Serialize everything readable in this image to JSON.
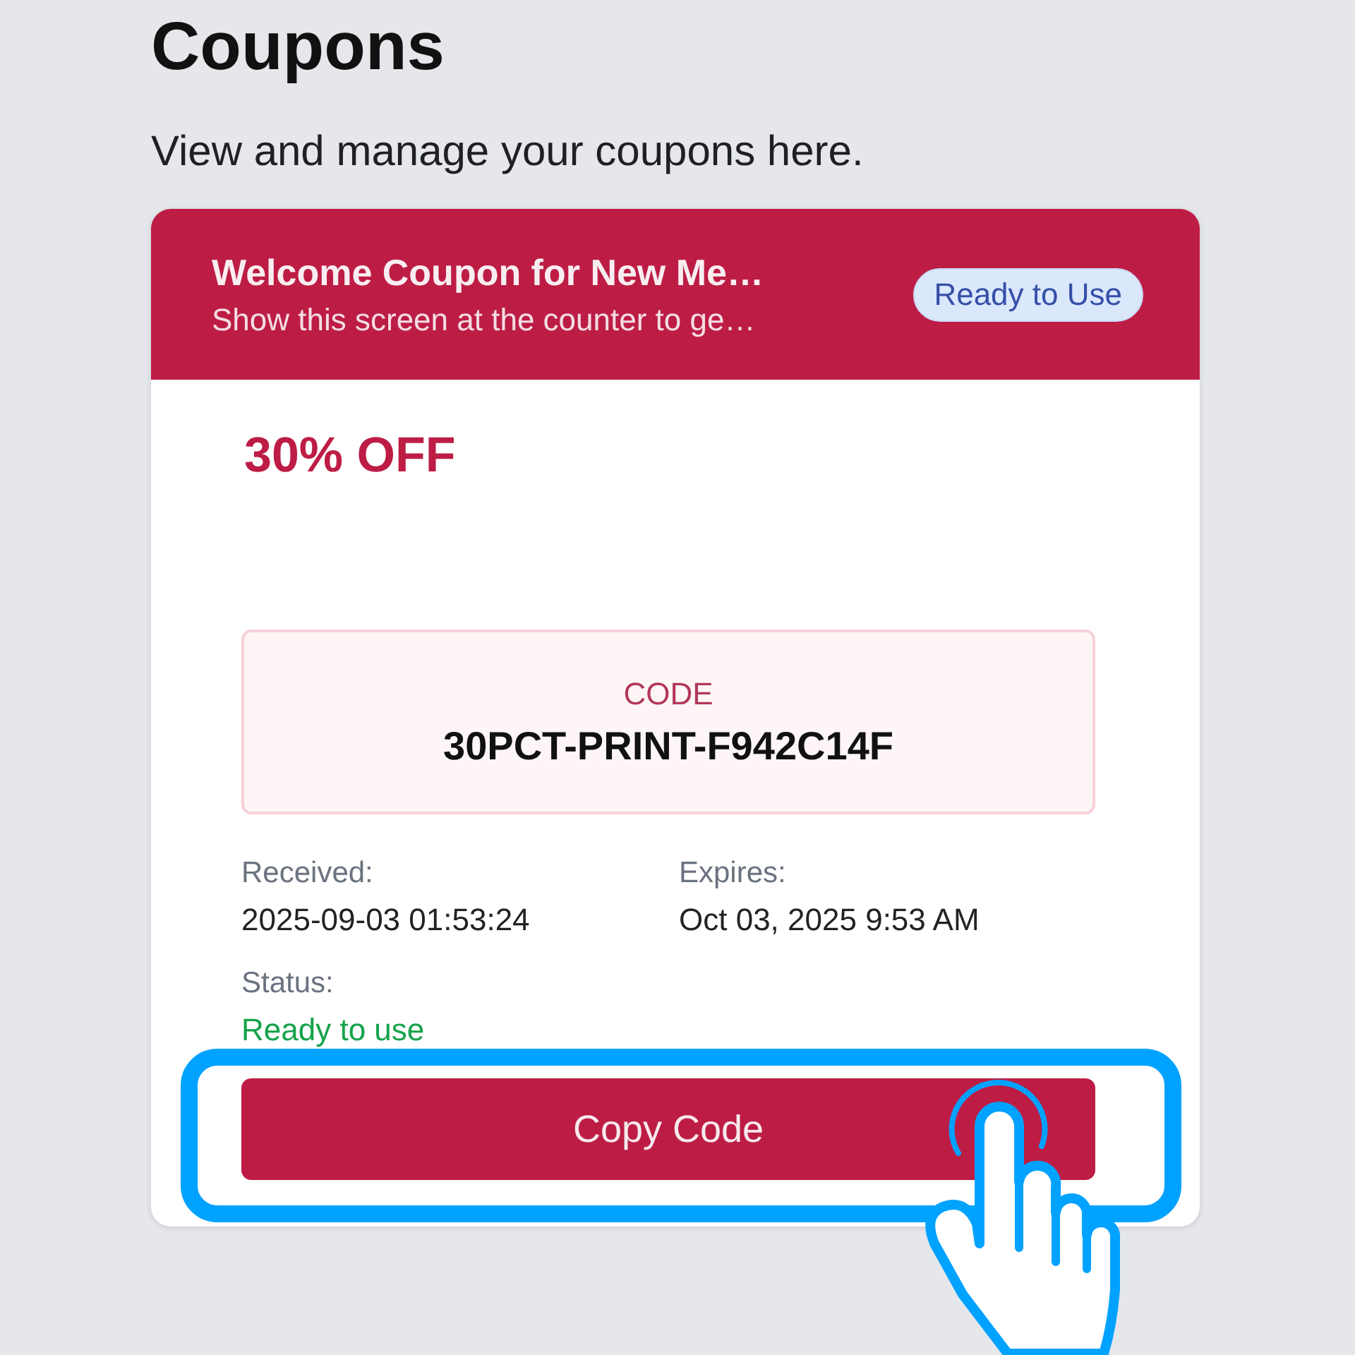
{
  "page": {
    "title": "Coupons",
    "subtitle": "View and manage your coupons here."
  },
  "coupon": {
    "title": "Welcome Coupon for New Me…",
    "description": "Show this screen at the counter to ge…",
    "badge": "Ready to Use",
    "discount": "30% OFF",
    "code_label": "CODE",
    "code": "30PCT-PRINT-F942C14F",
    "details": [
      {
        "kind": "plain",
        "label": "Received:",
        "value": "2025-09-03 01:53:24"
      },
      {
        "kind": "plain",
        "label": "Expires:",
        "value": "Oct 03, 2025 9:53 AM"
      },
      {
        "kind": "status",
        "label": "Status:",
        "value": "Ready to use"
      }
    ],
    "button": {
      "label": "Copy Code",
      "highlighted": true
    }
  }
}
